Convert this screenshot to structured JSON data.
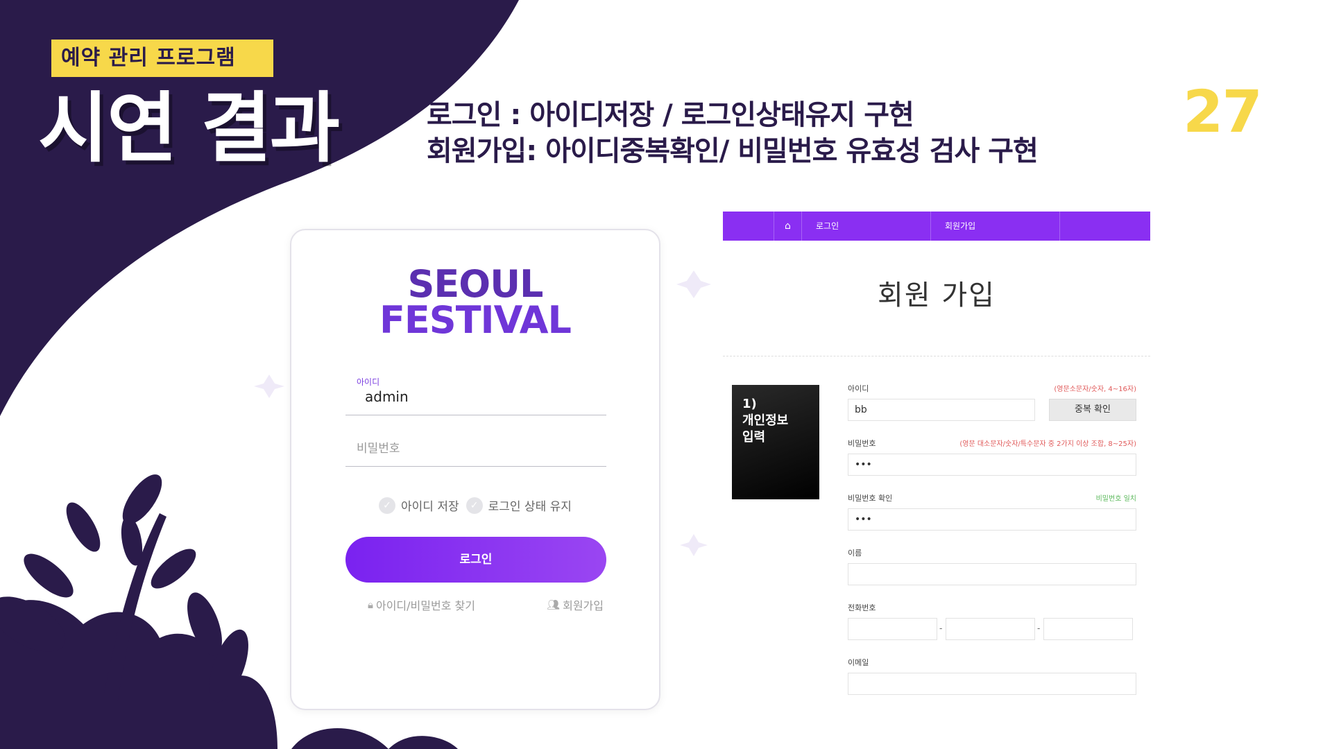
{
  "slide": {
    "tag": "예약 관리 프로그램",
    "title": "시연 결과",
    "headline_line1": "로그인 : 아이디저장 / 로그인상태유지 구현",
    "headline_line2": "회원가입: 아이디중복확인/ 비밀번호 유효성 검사 구현",
    "page_number": "27"
  },
  "colors": {
    "dark_purple": "#2a1b4a",
    "yellow": "#f7d84a",
    "accent_purple": "#8a2ff2"
  },
  "login": {
    "logo_line1": "SEOUL",
    "logo_line2": "FESTIVAL",
    "id_label": "아이디",
    "id_value": "admin",
    "pw_placeholder": "비밀번호",
    "save_id_label": "아이디 저장",
    "keep_login_label": "로그인 상태 유지",
    "login_button": "로그인",
    "find_link": "아이디/비밀번호 찾기",
    "join_link": "회원가입"
  },
  "signup": {
    "nav": {
      "home_icon": "home-icon",
      "login": "로그인",
      "join": "회원가입"
    },
    "title": "회원 가입",
    "step_number": "1)",
    "step_line1": "개인정보",
    "step_line2": "입력",
    "id_label": "아이디",
    "id_hint": "(영문소문자/숫자, 4~16자)",
    "id_value": "bb",
    "dup_button": "중복 확인",
    "pw_label": "비밀번호",
    "pw_hint": "(영문 대소문자/숫자/특수문자 중 2가지 이상 조합, 8~25자)",
    "pw_value": "•••",
    "pw_confirm_label": "비밀번호 확인",
    "pw_confirm_hint": "비밀번호 일치",
    "pw_confirm_value": "•••",
    "name_label": "이름",
    "phone_label": "전화번호",
    "phone_sep": "-",
    "email_label": "이메일"
  }
}
